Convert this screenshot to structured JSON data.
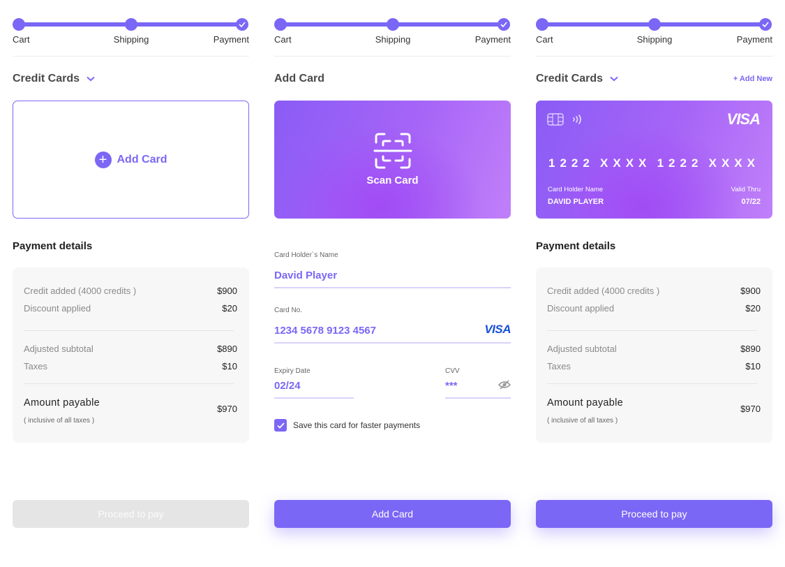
{
  "colors": {
    "accent": "#7a67f5",
    "visa_blue": "#1a4fd8",
    "disabled": "#e5e5e5"
  },
  "stepper": {
    "steps": [
      "Cart",
      "Shipping",
      "Payment"
    ]
  },
  "panel1": {
    "title": "Credit Cards",
    "add_card_label": "Add Card",
    "details_title": "Payment details",
    "rows": [
      {
        "label": "Credit added (4000 credits )",
        "value": "$900"
      },
      {
        "label": "Discount applied",
        "value": "$20"
      },
      {
        "label": "Adjusted subtotal",
        "value": "$890"
      },
      {
        "label": "Taxes",
        "value": "$10"
      }
    ],
    "amount_label": "Amount payable",
    "amount_note": "( inclusive of all taxes )",
    "amount_value": "$970",
    "button": "Proceed to pay"
  },
  "panel2": {
    "title": "Add Card",
    "scan_label": "Scan Card",
    "holder_label": "Card Holder`s Name",
    "holder_value": "David Player",
    "number_label": "Card No.",
    "number_value": "1234 5678 9123 4567",
    "brand": "VISA",
    "expiry_label": "Expiry Date",
    "expiry_value": "02/24",
    "cvv_label": "CVV",
    "cvv_value": "***",
    "save_label": "Save this card for faster payments",
    "save_checked": true,
    "button": "Add Card"
  },
  "panel3": {
    "title": "Credit Cards",
    "add_new": "+ Add New",
    "card": {
      "brand": "VISA",
      "number_groups": [
        "1222",
        "XXXX",
        "1222",
        "XXXX"
      ],
      "holder_label": "Card Holder Name",
      "holder_value": "DAVID PLAYER",
      "valid_label": "Valid Thru",
      "valid_value": "07/22"
    },
    "details_title": "Payment details",
    "rows": [
      {
        "label": "Credit added (4000 credits )",
        "value": "$900"
      },
      {
        "label": "Discount applied",
        "value": "$20"
      },
      {
        "label": "Adjusted subtotal",
        "value": "$890"
      },
      {
        "label": "Taxes",
        "value": "$10"
      }
    ],
    "amount_label": "Amount payable",
    "amount_note": "( inclusive of all taxes )",
    "amount_value": "$970",
    "button": "Proceed to pay"
  }
}
